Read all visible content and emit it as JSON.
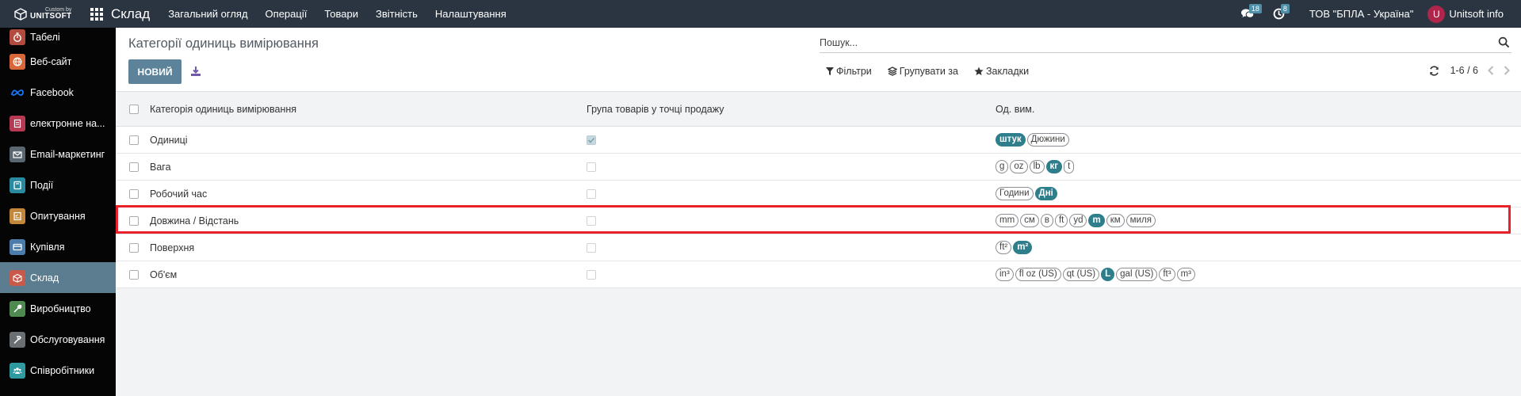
{
  "topbar": {
    "logo_small": "Custom by",
    "logo_big": "UNITSOFT",
    "app_title": "Склад",
    "menu": [
      "Загальний огляд",
      "Операції",
      "Товари",
      "Звітність",
      "Налаштування"
    ],
    "messages_count": "18",
    "activities_count": "8",
    "company": "ТОВ \"БПЛА - Україна\"",
    "avatar_letter": "U",
    "user_name": "Unitsoft info"
  },
  "sidebar": {
    "items": [
      {
        "label": "Табелі",
        "icon": "stopwatch-icon",
        "color": "#b24b3e"
      },
      {
        "label": "Веб-сайт",
        "icon": "globe-icon",
        "color": "#d9673a"
      },
      {
        "label": "Facebook",
        "icon": "meta-icon",
        "color": "#050505"
      },
      {
        "label": "електронне на...",
        "icon": "doc-icon",
        "color": "#b73a55"
      },
      {
        "label": "Email-маркетинг",
        "icon": "mail-icon",
        "color": "#5a6670"
      },
      {
        "label": "Події",
        "icon": "ticket-icon",
        "color": "#2a8ba0"
      },
      {
        "label": "Опитування",
        "icon": "survey-icon",
        "color": "#c2873a"
      },
      {
        "label": "Купівля",
        "icon": "card-icon",
        "color": "#4a7dab"
      },
      {
        "label": "Склад",
        "icon": "box-icon",
        "color": "#c95a4a"
      },
      {
        "label": "Виробництво",
        "icon": "wrench-icon",
        "color": "#4f8a50"
      },
      {
        "label": "Обслуговування",
        "icon": "hammer-icon",
        "color": "#6a6f74"
      },
      {
        "label": "Співробітники",
        "icon": "people-icon",
        "color": "#2f9aa0"
      }
    ],
    "active_index": 8
  },
  "control_panel": {
    "breadcrumb": "Категорії одиниць вимірювання",
    "new_button": "НОВИЙ",
    "search_placeholder": "Пошук...",
    "filters": "Фільтри",
    "group_by": "Групувати за",
    "favorites": "Закладки",
    "pager": "1-6 / 6"
  },
  "table": {
    "headers": {
      "name": "Категорія одиниць вимірювання",
      "pos_group": "Група товарів у точці продажу",
      "uom": "Од. вим."
    },
    "rows": [
      {
        "name": "Одиниці",
        "pos": true,
        "uoms": [
          {
            "t": "штук",
            "ref": true
          },
          {
            "t": "Дюжини",
            "ref": false
          }
        ]
      },
      {
        "name": "Вага",
        "pos": false,
        "uoms": [
          {
            "t": "g",
            "ref": false
          },
          {
            "t": "oz",
            "ref": false
          },
          {
            "t": "lb",
            "ref": false
          },
          {
            "t": "кг",
            "ref": true
          },
          {
            "t": "t",
            "ref": false
          }
        ]
      },
      {
        "name": "Робочий час",
        "pos": false,
        "uoms": [
          {
            "t": "Години",
            "ref": false
          },
          {
            "t": "Дні",
            "ref": true
          }
        ]
      },
      {
        "name": "Довжина / Відстань",
        "pos": false,
        "uoms": [
          {
            "t": "mm",
            "ref": false
          },
          {
            "t": "см",
            "ref": false
          },
          {
            "t": "в",
            "ref": false
          },
          {
            "t": "ft",
            "ref": false
          },
          {
            "t": "yd",
            "ref": false
          },
          {
            "t": "m",
            "ref": true
          },
          {
            "t": "км",
            "ref": false
          },
          {
            "t": "миля",
            "ref": false
          }
        ]
      },
      {
        "name": "Поверхня",
        "pos": false,
        "uoms": [
          {
            "t": "ft²",
            "ref": false
          },
          {
            "t": "m²",
            "ref": true
          }
        ]
      },
      {
        "name": "Об'єм",
        "pos": false,
        "uoms": [
          {
            "t": "in³",
            "ref": false
          },
          {
            "t": "fl oz (US)",
            "ref": false
          },
          {
            "t": "qt (US)",
            "ref": false
          },
          {
            "t": "L",
            "ref": true
          },
          {
            "t": "gal (US)",
            "ref": false
          },
          {
            "t": "ft³",
            "ref": false
          },
          {
            "t": "m³",
            "ref": false
          }
        ]
      }
    ],
    "highlighted_row": 3
  }
}
